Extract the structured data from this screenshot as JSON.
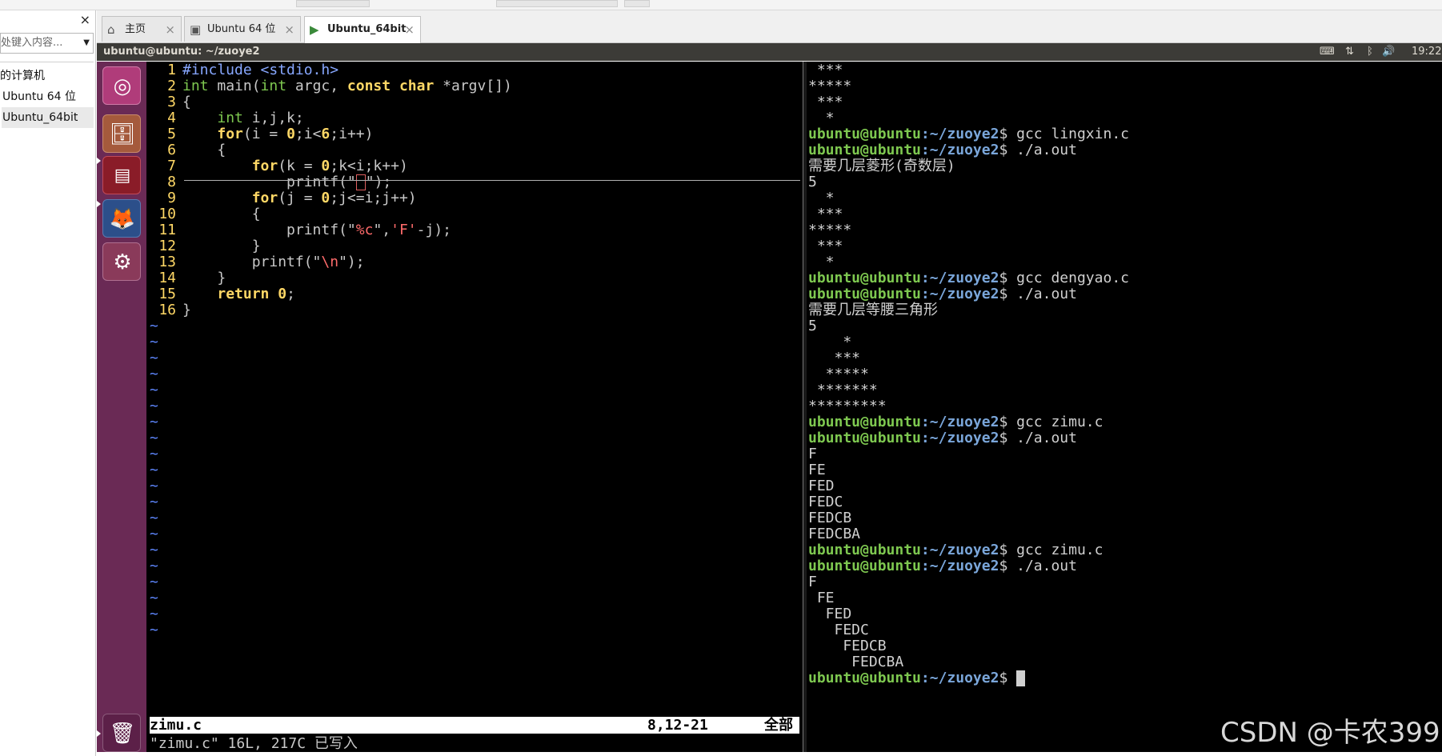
{
  "library": {
    "close_glyph": "×",
    "search_placeholder": "处键入内容...",
    "items": [
      "的计算机",
      "Ubuntu 64 位",
      "Ubuntu_64bit"
    ]
  },
  "tabs": [
    {
      "label": "主页",
      "icon": "home-icon"
    },
    {
      "label": "Ubuntu 64 位",
      "icon": "vm-icon"
    },
    {
      "label": "Ubuntu_64bit",
      "icon": "vm-running-icon"
    }
  ],
  "panel": {
    "title": "ubuntu@ubuntu: ~/zuoye2",
    "time": "19:22"
  },
  "vim": {
    "lines": [
      {
        "n": "1"
      },
      {
        "n": "2"
      },
      {
        "n": "3"
      },
      {
        "n": "4"
      },
      {
        "n": "5"
      },
      {
        "n": "6"
      },
      {
        "n": "7"
      },
      {
        "n": "8"
      },
      {
        "n": "9"
      },
      {
        "n": "10"
      },
      {
        "n": "11"
      },
      {
        "n": "12"
      },
      {
        "n": "13"
      },
      {
        "n": "14"
      },
      {
        "n": "15"
      },
      {
        "n": "16"
      }
    ],
    "code": {
      "l1a": "#include",
      "l1b": " <stdio.h>",
      "l2a": "int",
      "l2b": " main(",
      "l2c": "int",
      "l2d": " argc, ",
      "l2e": "const",
      "l2f": " ",
      "l2g": "char",
      "l2h": " *argv[])",
      "l3": "{",
      "l4a": "    ",
      "l4b": "int",
      "l4c": " i,j,k;",
      "l5a": "    ",
      "l5b": "for",
      "l5c": "(i = ",
      "l5d": "0",
      "l5e": ";i<",
      "l5f": "6",
      "l5g": ";i++)",
      "l6": "    {",
      "l7a": "        ",
      "l7b": "for",
      "l7c": "(k = ",
      "l7d": "0",
      "l7e": ";k<i;k++)",
      "l8a": "            printf(\"",
      "l8b": "\");",
      "l9a": "        ",
      "l9b": "for",
      "l9c": "(j = ",
      "l9d": "0",
      "l9e": ";j<=i;j++)",
      "l10": "        {",
      "l11a": "            printf(\"",
      "l11b": "%c",
      "l11c": "\",",
      "l11d": "'F'",
      "l11e": "-j);",
      "l12": "        }",
      "l13a": "        printf(\"",
      "l13b": "\\n",
      "l13c": "\");",
      "l14": "    }",
      "l15a": "    ",
      "l15b": "return",
      "l15c": " ",
      "l15d": "0",
      "l15e": ";",
      "l16": "}"
    },
    "tilde": "~",
    "status_file": "zimu.c",
    "status_pos": "8,12-21",
    "status_pct": "全部",
    "cmdline": "\"zimu.c\" 16L, 217C 已写入"
  },
  "terminal": {
    "prompt_user": "ubuntu@ubuntu",
    "prompt_path": ":~/zuoye2",
    "lines": [
      {
        "t": "out",
        "text": " ***"
      },
      {
        "t": "out",
        "text": "*****"
      },
      {
        "t": "out",
        "text": " ***"
      },
      {
        "t": "out",
        "text": "  *"
      },
      {
        "t": "cmd",
        "text": "$ gcc lingxin.c"
      },
      {
        "t": "cmd",
        "text": "$ ./a.out"
      },
      {
        "t": "out",
        "text": "需要几层菱形(奇数层)"
      },
      {
        "t": "out",
        "text": "5"
      },
      {
        "t": "out",
        "text": "  *"
      },
      {
        "t": "out",
        "text": " ***"
      },
      {
        "t": "out",
        "text": "*****"
      },
      {
        "t": "out",
        "text": " ***"
      },
      {
        "t": "out",
        "text": "  *"
      },
      {
        "t": "cmd",
        "text": "$ gcc dengyao.c"
      },
      {
        "t": "cmd",
        "text": "$ ./a.out"
      },
      {
        "t": "out",
        "text": "需要几层等腰三角形"
      },
      {
        "t": "out",
        "text": "5"
      },
      {
        "t": "out",
        "text": "    *"
      },
      {
        "t": "out",
        "text": "   ***"
      },
      {
        "t": "out",
        "text": "  *****"
      },
      {
        "t": "out",
        "text": " *******"
      },
      {
        "t": "out",
        "text": "*********"
      },
      {
        "t": "cmd",
        "text": "$ gcc zimu.c"
      },
      {
        "t": "cmd",
        "text": "$ ./a.out"
      },
      {
        "t": "out",
        "text": "F"
      },
      {
        "t": "out",
        "text": "FE"
      },
      {
        "t": "out",
        "text": "FED"
      },
      {
        "t": "out",
        "text": "FEDC"
      },
      {
        "t": "out",
        "text": "FEDCB"
      },
      {
        "t": "out",
        "text": "FEDCBA"
      },
      {
        "t": "cmd",
        "text": "$ gcc zimu.c"
      },
      {
        "t": "cmd",
        "text": "$ ./a.out"
      },
      {
        "t": "out",
        "text": "F"
      },
      {
        "t": "out",
        "text": " FE"
      },
      {
        "t": "out",
        "text": "  FED"
      },
      {
        "t": "out",
        "text": "   FEDC"
      },
      {
        "t": "out",
        "text": "    FEDCB"
      },
      {
        "t": "out",
        "text": "     FEDCBA"
      },
      {
        "t": "cmd",
        "text": "$ "
      }
    ]
  },
  "watermark": "CSDN @卡农399"
}
